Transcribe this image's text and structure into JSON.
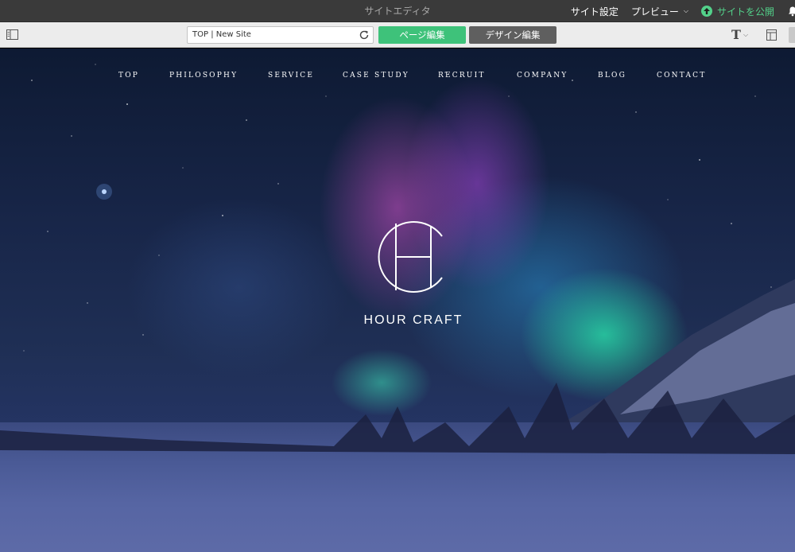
{
  "app": {
    "title": "サイトエディタ",
    "site_settings": "サイト設定",
    "preview": "プレビュー",
    "publish": "サイトを公開"
  },
  "toolbar": {
    "url_value": "TOP | New Site",
    "page_edit": "ページ編集",
    "design_edit": "デザイン編集"
  },
  "site": {
    "nav": [
      "TOP",
      "PHILOSOPHY",
      "SERVICE",
      "CASE STUDY",
      "RECRUIT",
      "COMPANY",
      "BLOG",
      "CONTACT"
    ],
    "brand": "HOUR CRAFT"
  },
  "colors": {
    "accent_green": "#3ec27a",
    "publish_green": "#53d18a",
    "dark_button": "#5f5f5f"
  }
}
